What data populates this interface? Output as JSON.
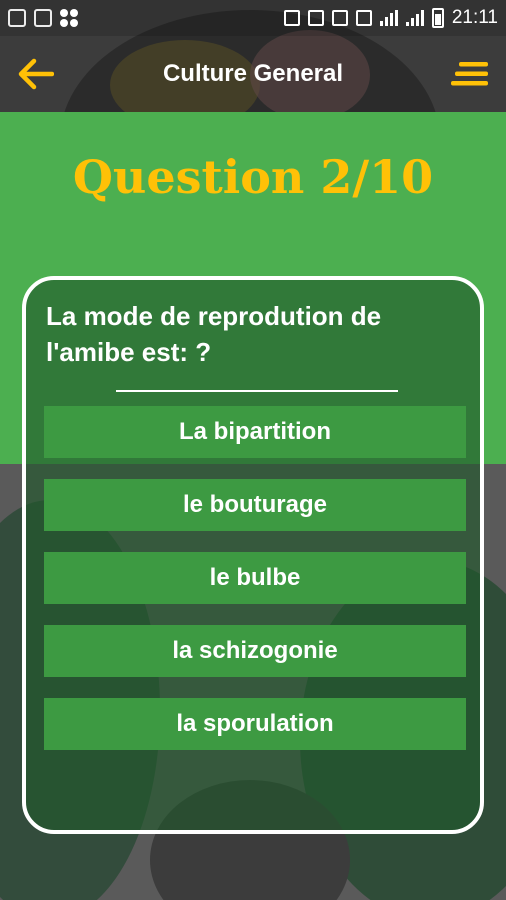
{
  "status_bar": {
    "time": "21:11"
  },
  "toolbar": {
    "title": "Culture General"
  },
  "quiz": {
    "question_number": "Question 2/10",
    "question_text": "La mode de reprodution de l'amibe est: ?",
    "answers": [
      {
        "label": "La bipartition"
      },
      {
        "label": "le bouturage"
      },
      {
        "label": "le bulbe"
      },
      {
        "label": "la schizogonie"
      },
      {
        "label": "la sporulation"
      }
    ]
  },
  "colors": {
    "accent": "#ffc107",
    "green": "#4caf50",
    "answer_green": "#3d9a42"
  }
}
